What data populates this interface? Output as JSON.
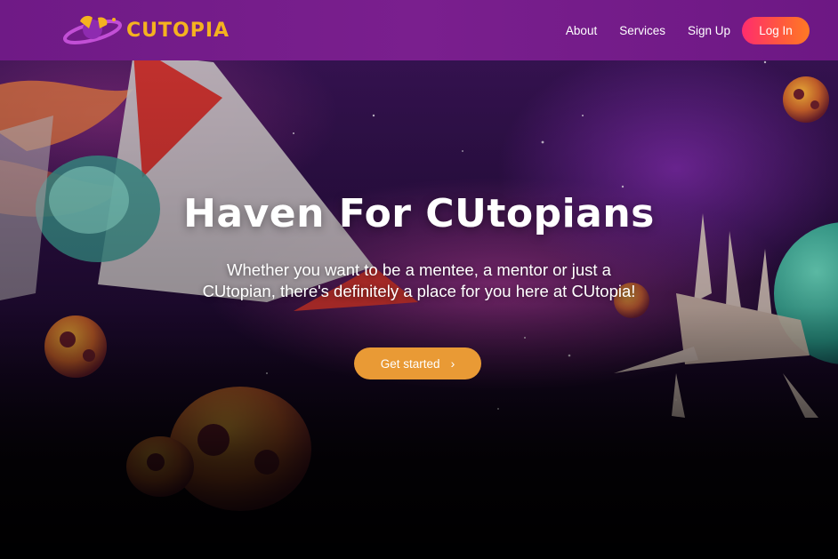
{
  "brand": {
    "name": "CUTOPIA",
    "logo_icon": "ringed-planet-logo-icon"
  },
  "nav": {
    "links": [
      "About",
      "Services",
      "Sign Up"
    ],
    "login_label": "Log In"
  },
  "hero": {
    "title": "Haven For CUtopians",
    "subtitle": "Whether you want to be a mentee, a mentor or just a CUtopian, there's definitely a place for you here at CUtopia!",
    "cta_label": "Get started",
    "cta_icon": "chevron-right-icon"
  },
  "colors": {
    "navbar": "#7a1f8e",
    "brand_text": "#f5b21f",
    "login_gradient_start": "#ff2d6e",
    "login_gradient_end": "#ff7a24",
    "cta": "#e99a35",
    "hero_text": "#ffffff"
  }
}
